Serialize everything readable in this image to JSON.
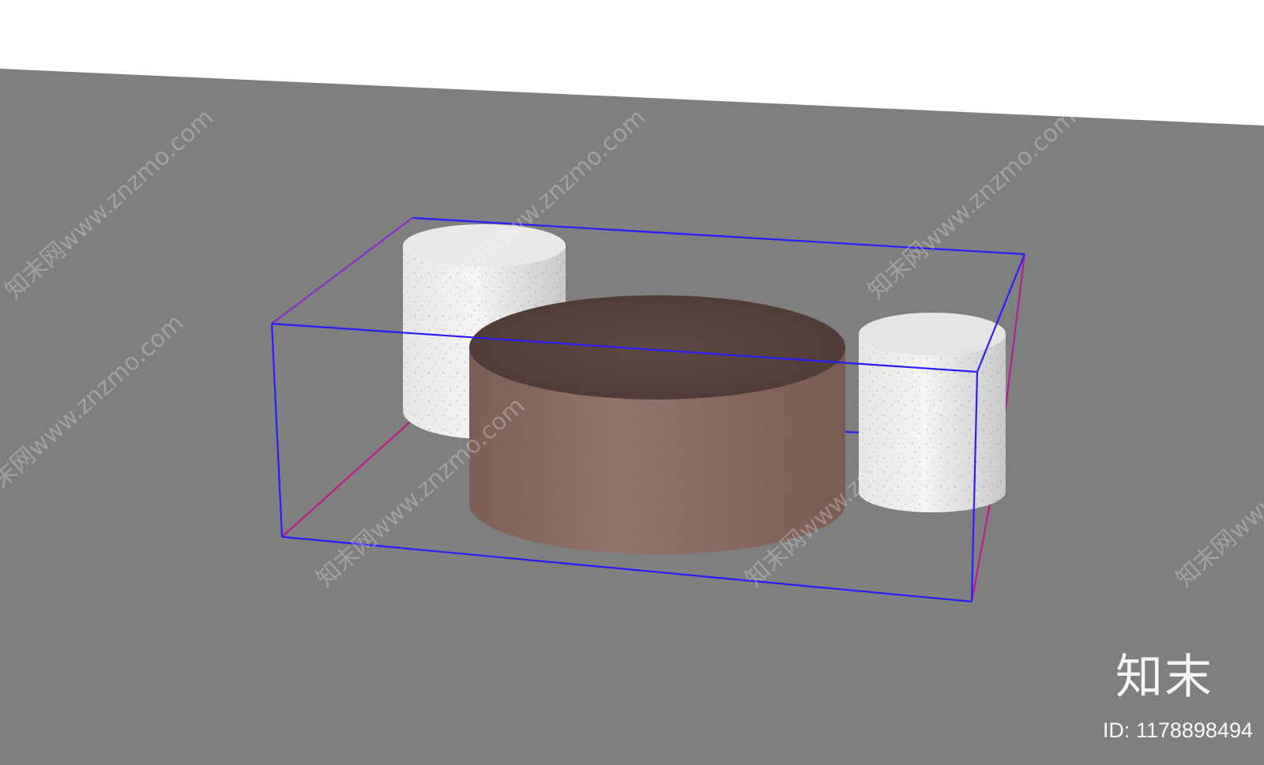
{
  "watermark": {
    "brand_logo": "知末",
    "asset_id": "ID: 1178898494",
    "diagonal_text": "知末网www.znzmo.com"
  },
  "scene": {
    "colors": {
      "page": "#ffffff",
      "ground": "#7f7f7f",
      "bounding_box": "#2b1bff",
      "bounding_box_accent": "#c0188a",
      "stool_light": "#f2f2f2",
      "stool_shade": "#c9c9c9",
      "table_top": "#5a4440",
      "table_side": "#8b6a60"
    }
  }
}
